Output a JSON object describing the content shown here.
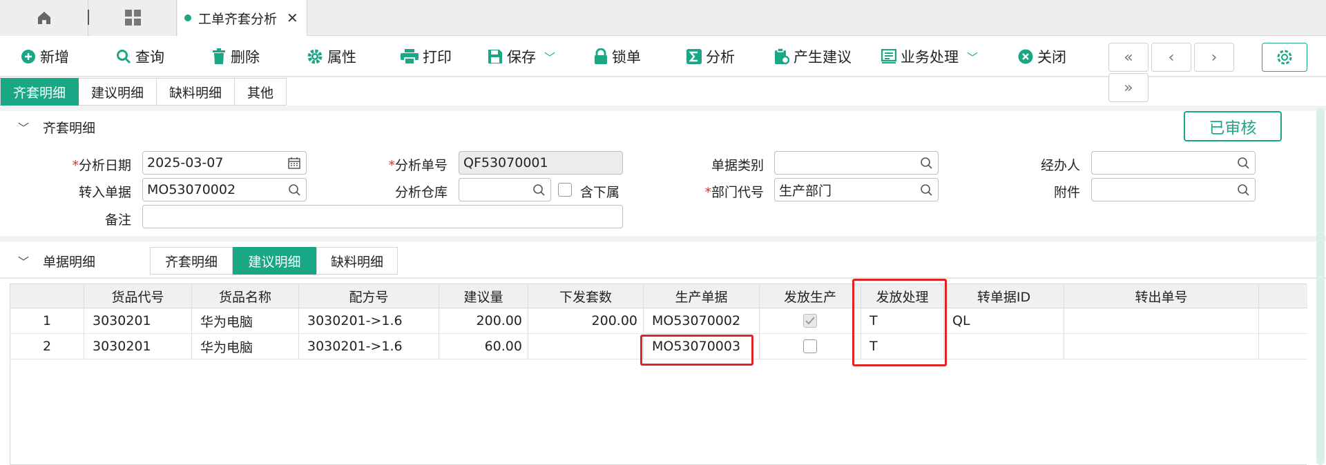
{
  "tabs": {
    "active_label": "工单齐套分析"
  },
  "toolbar": {
    "add": "新增",
    "query": "查询",
    "delete": "删除",
    "props": "属性",
    "print": "打印",
    "save": "保存",
    "lock": "锁单",
    "analyze": "分析",
    "suggest": "产生建议",
    "business": "业务处理",
    "close": "关闭"
  },
  "subtabs": [
    "齐套明细",
    "建议明细",
    "缺料明细",
    "其他"
  ],
  "section1": {
    "title": "齐套明细",
    "status": "已审核"
  },
  "form": {
    "analysis_date_label": "分析日期",
    "analysis_date": "2025-03-07",
    "analysis_no_label": "分析单号",
    "analysis_no": "QF53070001",
    "doc_type_label": "单据类别",
    "doc_type": "",
    "handler_label": "经办人",
    "handler": "",
    "source_doc_label": "转入单据",
    "source_doc": "MO53070002",
    "warehouse_label": "分析仓库",
    "warehouse": "",
    "include_sub_label": "含下属",
    "dept_label": "部门代号",
    "dept": "生产部门",
    "attach_label": "附件",
    "attach": "",
    "remark_label": "备注",
    "remark": ""
  },
  "section2": {
    "title": "单据明细",
    "tabs": [
      "齐套明细",
      "建议明细",
      "缺料明细"
    ]
  },
  "table": {
    "headers": [
      "",
      "货品代号",
      "货品名称",
      "配方号",
      "建议量",
      "下发套数",
      "生产单据",
      "发放生产",
      "发放处理",
      "转单据ID",
      "转出单号"
    ],
    "rows": [
      {
        "no": "1",
        "code": "3030201",
        "name": "华为电脑",
        "formula": "3030201->1.6",
        "qty": "200.00",
        "sets": "200.00",
        "mo": "MO53070002",
        "released": true,
        "handle": "T",
        "doc_id": "QL",
        "out_no": ""
      },
      {
        "no": "2",
        "code": "3030201",
        "name": "华为电脑",
        "formula": "3030201->1.6",
        "qty": "60.00",
        "sets": "",
        "mo": "MO53070003",
        "released": false,
        "handle": "T",
        "doc_id": "",
        "out_no": ""
      }
    ]
  },
  "colors": {
    "accent": "#1aa785",
    "highlight": "#e02424",
    "required": "#e0322d"
  }
}
